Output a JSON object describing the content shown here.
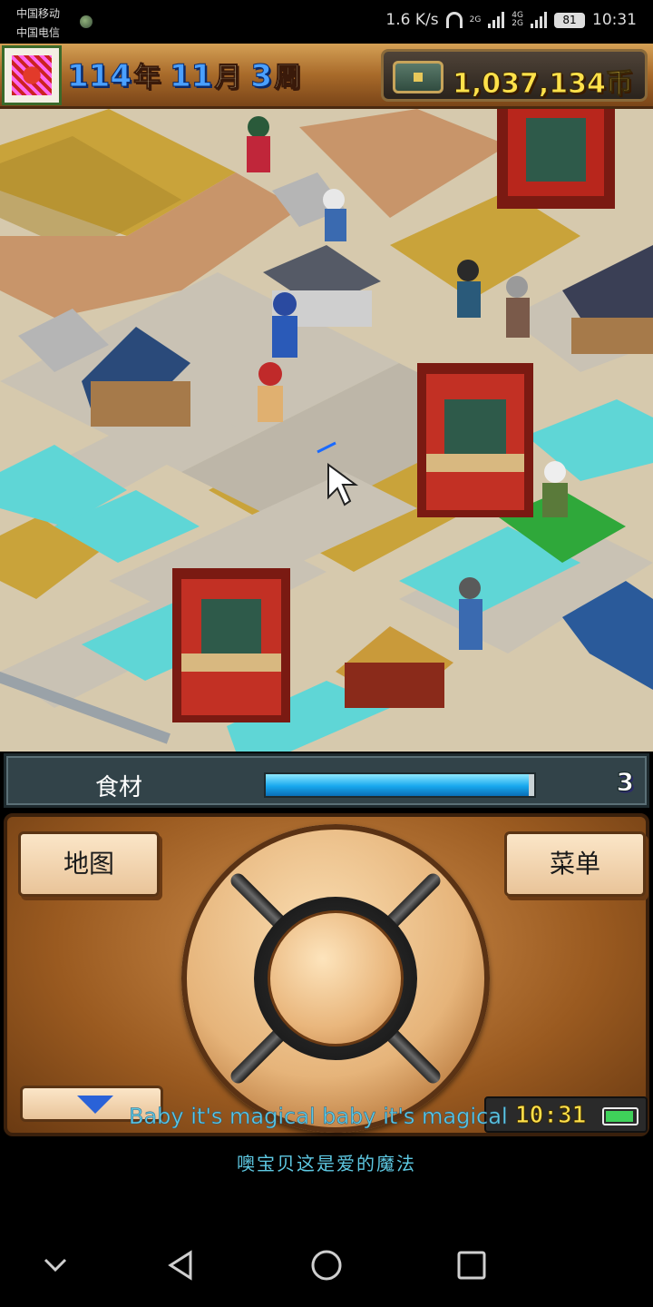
{
  "status_bar": {
    "carrier_1": "中国移动",
    "carrier_2": "中国电信",
    "speed": "1.6 K/s",
    "net_1": "2G",
    "net_2a": "4G",
    "net_2b": "2G",
    "battery": "81",
    "time": "10:31"
  },
  "hud": {
    "year": "114",
    "year_unit": "年",
    "month": "11",
    "month_unit": "月",
    "week": "3",
    "week_unit": "周",
    "money": "1,037,134币"
  },
  "map": {
    "description_icon": "isometric-town-map"
  },
  "resource": {
    "label": "食材",
    "fill_fraction": 0.98,
    "count": "3"
  },
  "controls": {
    "map_label": "地图",
    "menu_label": "菜单",
    "clock_time": "10:31"
  },
  "lyrics": {
    "english": "Baby it's magical baby it's magical",
    "chinese": "噢宝贝这是爱的魔法"
  },
  "colors": {
    "road": "#c9c2b4",
    "field": "#c9a33a",
    "water": "#5fd6d6",
    "wood": "#b97a3e",
    "res_fill": "#18a8ee"
  }
}
